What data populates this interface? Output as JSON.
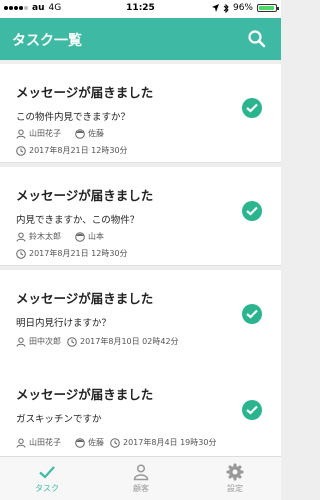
{
  "status_bar": {
    "carrier": "au",
    "network": "4G",
    "time": "11:25",
    "battery": "96%",
    "battery_level": 0.96
  },
  "header": {
    "title": "タスク一覧"
  },
  "tasks": [
    {
      "title": "メッセージが届きました",
      "message": "この物件内見できますか？",
      "sender": "山田花子",
      "agent": "佐藤",
      "datetime": "2017年8月21日 12時30分",
      "done": true
    },
    {
      "title": "メッセージが届きました",
      "message": "内見できますか、この物件？",
      "sender": "鈴木太郎",
      "agent": "山本",
      "datetime": "2017年8月21日 12時30分",
      "done": true
    },
    {
      "title": "メッセージが届きました",
      "message": "明日内見行けますか？",
      "sender": "田中次郎",
      "agent": "",
      "datetime": "2017年8月10日 02時42分",
      "done": true
    },
    {
      "title": "メッセージが届きました",
      "message": "ガスキッチンですか",
      "sender": "山田花子",
      "agent": "佐藤",
      "datetime": "2017年8月4日 19時30分",
      "done": true
    }
  ],
  "tabbar": {
    "items": [
      {
        "label": "タスク"
      },
      {
        "label": "顧客"
      },
      {
        "label": "設定"
      }
    ]
  },
  "colors": {
    "accent": "#3ebaa4",
    "check": "#2bb58f"
  }
}
